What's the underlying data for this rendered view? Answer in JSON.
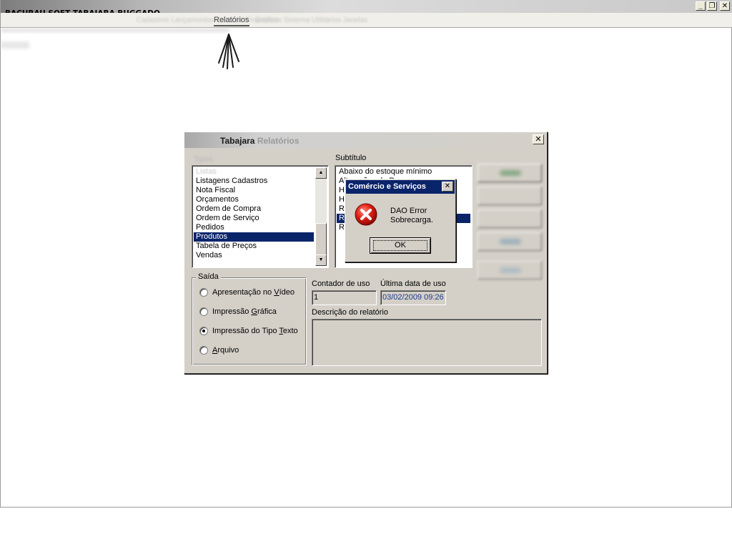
{
  "app": {
    "title": "BACURAU SOFT TABAJARA BUGGADO",
    "window_controls": [
      "_",
      "❐",
      "✕"
    ]
  },
  "menubar": {
    "active_item": "Relatórios",
    "blurred_items": [
      "Cadastros  Lançamentos  Controle Financeiro",
      "Gráficos   Sistema   Utilitários   Janelas"
    ]
  },
  "dialog": {
    "title_part1": "Tabajara",
    "title_part2": "Relatórios",
    "close": "✕",
    "group_label": "Tipos",
    "types_list": [
      {
        "label": "Listas",
        "state": "faded"
      },
      {
        "label": "Listagens Cadastros",
        "state": ""
      },
      {
        "label": "Nota Fiscal",
        "state": ""
      },
      {
        "label": "Orçamentos",
        "state": ""
      },
      {
        "label": "Ordem de Compra",
        "state": ""
      },
      {
        "label": "Ordem de Serviço",
        "state": ""
      },
      {
        "label": "Pedidos",
        "state": ""
      },
      {
        "label": "Produtos",
        "state": "sel"
      },
      {
        "label": "Tabela de Preços",
        "state": ""
      },
      {
        "label": "Vendas",
        "state": ""
      }
    ],
    "subtitle_label": "Subtítulo",
    "subtitle_list": [
      {
        "label": "Abaixo do estoque mínimo",
        "state": ""
      },
      {
        "label": "Alterações de Preços",
        "state": ""
      },
      {
        "label": "Histórico",
        "state": ""
      },
      {
        "label": "Histórico de Entradas",
        "state": ""
      },
      {
        "label": "Relação",
        "state": ""
      },
      {
        "label": "Relação Completa",
        "state": "sel"
      },
      {
        "label": "Relação Simples",
        "state": ""
      }
    ],
    "saida": {
      "title": "Saída",
      "options": [
        {
          "pre": "Apresentação no ",
          "u": "V",
          "post": "ídeo",
          "checked": false
        },
        {
          "pre": "Impressão ",
          "u": "G",
          "post": "ráfica",
          "checked": false
        },
        {
          "pre": "Impressão do Tipo ",
          "u": "T",
          "post": "exto",
          "checked": true
        },
        {
          "pre": "",
          "u": "A",
          "post": "rquivo",
          "checked": false
        }
      ]
    },
    "contador_label": "Contador de uso",
    "contador_value": "1",
    "ultima_label": "Última data de  uso",
    "ultima_value": "03/02/2009 09:26",
    "descricao_label": "Descrição do relatório",
    "descricao_value": ""
  },
  "error_box": {
    "title": "Comércio e Serviços",
    "close": "✕",
    "line1": "DAO Error",
    "line2": "Sobrecarga.",
    "ok_label": "OK",
    "icon": "error-icon"
  }
}
